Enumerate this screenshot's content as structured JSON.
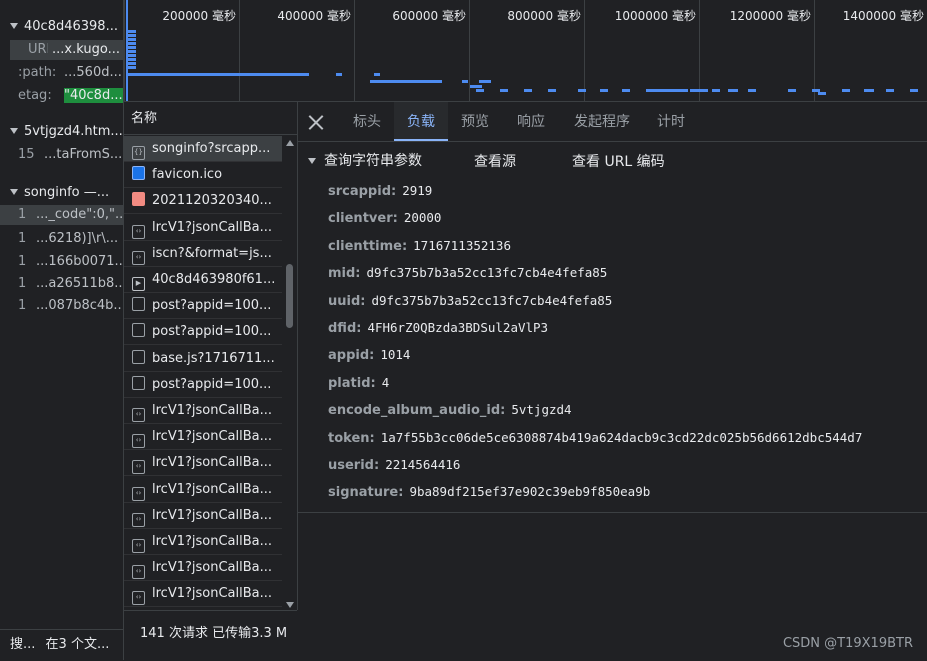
{
  "left_panel": {
    "groups": [
      {
        "title": "40c8d46398...",
        "lines": [
          {
            "key": "URL",
            "value": "...x.kugo..."
          },
          {
            "key": ":path:",
            "value": "...560d..."
          },
          {
            "key": "etag:",
            "value": "\"40c8d..."
          }
        ]
      },
      {
        "title": "5vtjgzd4.htm...",
        "lines": [
          {
            "key": "15",
            "value": "...taFromS..."
          }
        ]
      },
      {
        "title": "songinfo —...",
        "lines": [
          {
            "key": "1",
            "value": "..._code\":0,\"..."
          },
          {
            "key": "1",
            "value": "...6218)]\\r\\..."
          },
          {
            "key": "1",
            "value": "...166b0071..."
          },
          {
            "key": "1",
            "value": "...a26511b8..."
          },
          {
            "key": "1",
            "value": "...087b8c4b..."
          }
        ]
      }
    ],
    "footer": {
      "search": "搜...",
      "summary": "在3 个文..."
    }
  },
  "timeline": {
    "ticks": [
      "200000 毫秒",
      "400000 毫秒",
      "600000 毫秒",
      "800000 毫秒",
      "1000000 毫秒",
      "1200000 毫秒",
      "1400000 毫秒"
    ]
  },
  "request_list": {
    "header": "名称",
    "items": [
      {
        "icon": "xhr-icon",
        "name": "songinfo?srcapp..."
      },
      {
        "icon": "favicon-icon",
        "name": "favicon.ico"
      },
      {
        "icon": "image-icon",
        "name": "2021120320340..."
      },
      {
        "icon": "script-icon",
        "name": "lrcV1?jsonCallBa..."
      },
      {
        "icon": "script-icon",
        "name": "iscn?&format=js..."
      },
      {
        "icon": "media-icon",
        "name": "40c8d463980f61..."
      },
      {
        "icon": "document-icon",
        "name": "post?appid=100..."
      },
      {
        "icon": "document-icon",
        "name": "post?appid=100..."
      },
      {
        "icon": "document-icon",
        "name": "base.js?1716711..."
      },
      {
        "icon": "document-icon",
        "name": "post?appid=100..."
      },
      {
        "icon": "script-icon",
        "name": "lrcV1?jsonCallBa..."
      },
      {
        "icon": "script-icon",
        "name": "lrcV1?jsonCallBa..."
      },
      {
        "icon": "script-icon",
        "name": "lrcV1?jsonCallBa..."
      },
      {
        "icon": "script-icon",
        "name": "lrcV1?jsonCallBa..."
      },
      {
        "icon": "script-icon",
        "name": "lrcV1?jsonCallBa..."
      },
      {
        "icon": "script-icon",
        "name": "lrcV1?jsonCallBa..."
      },
      {
        "icon": "script-icon",
        "name": "lrcV1?jsonCallBa..."
      },
      {
        "icon": "script-icon",
        "name": "lrcV1?jsonCallBa..."
      }
    ],
    "status": "141 次请求  已传输3.3 M"
  },
  "detail": {
    "tabs": [
      "标头",
      "负载",
      "预览",
      "响应",
      "发起程序",
      "计时"
    ],
    "active_tab": "负载",
    "section_title": "查询字符串参数",
    "view_source": "查看源",
    "view_url_encoded": "查看 URL 编码",
    "params": [
      {
        "key": "srcappid:",
        "value": "2919"
      },
      {
        "key": "clientver:",
        "value": "20000"
      },
      {
        "key": "clienttime:",
        "value": "1716711352136"
      },
      {
        "key": "mid:",
        "value": "d9fc375b7b3a52cc13fc7cb4e4fefa85"
      },
      {
        "key": "uuid:",
        "value": "d9fc375b7b3a52cc13fc7cb4e4fefa85"
      },
      {
        "key": "dfid:",
        "value": "4FH6rZ0QBzda3BDSul2aVlP3"
      },
      {
        "key": "appid:",
        "value": "1014"
      },
      {
        "key": "platid:",
        "value": "4"
      },
      {
        "key": "encode_album_audio_id:",
        "value": "5vtjgzd4"
      },
      {
        "key": "token:",
        "value": "1a7f55b3cc06de5ce6308874b419a624dacb9c3cd22dc025b56d6612dbc544d7"
      },
      {
        "key": "userid:",
        "value": "2214564416"
      },
      {
        "key": "signature:",
        "value": "9ba89df215ef37e902c39eb9f850ea9b"
      }
    ]
  },
  "watermark": "CSDN @T19X19BTR",
  "colors": {
    "accent": "#8ab4f8",
    "bar": "#4d8bf0",
    "etag_highlight": "#1e8e3e"
  }
}
